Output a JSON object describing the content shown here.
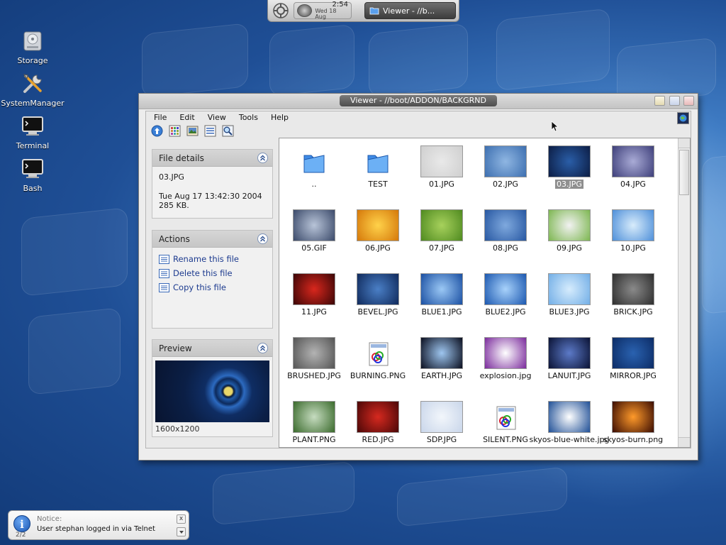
{
  "taskbar": {
    "time": "2:54",
    "date": "Wed 18 Aug",
    "task_label": "Viewer - //b..."
  },
  "desktop_icons": [
    {
      "label": "Storage",
      "icon": "storage-icon"
    },
    {
      "label": "SystemManager",
      "icon": "tools-icon"
    },
    {
      "label": "Terminal",
      "icon": "terminal-icon"
    },
    {
      "label": "Bash",
      "icon": "terminal-icon"
    }
  ],
  "window": {
    "title": "Viewer - //boot/ADDON/BACKGRND",
    "menu": [
      "File",
      "Edit",
      "View",
      "Tools",
      "Help"
    ],
    "toolbar": [
      "up-icon",
      "grid-view-icon",
      "thumbnail-view-icon",
      "list-view-icon",
      "search-icon"
    ]
  },
  "file_details": {
    "header": "File details",
    "filename": "03.JPG",
    "date": "Tue Aug 17 13:42:30 2004",
    "size": "285 KB."
  },
  "actions": {
    "header": "Actions",
    "items": [
      "Rename this file",
      "Delete this file",
      "Copy this file"
    ]
  },
  "preview": {
    "header": "Preview",
    "dimensions": "1600x1200"
  },
  "files": [
    {
      "name": "..",
      "kind": "folder"
    },
    {
      "name": "TEST",
      "kind": "folder"
    },
    {
      "name": "01.JPG",
      "kind": "image",
      "colors": [
        "#e9e9e9",
        "#cfcfcf"
      ]
    },
    {
      "name": "02.JPG",
      "kind": "image",
      "colors": [
        "#8fb6e2",
        "#3d6fb0"
      ]
    },
    {
      "name": "03.JPG",
      "kind": "image",
      "colors": [
        "#2a5ea8",
        "#0c1d44"
      ],
      "selected": true
    },
    {
      "name": "04.JPG",
      "kind": "image",
      "colors": [
        "#a9abd6",
        "#3e3f7a"
      ]
    },
    {
      "name": "05.GIF",
      "kind": "image",
      "colors": [
        "#b8c4d8",
        "#3b4a6a"
      ]
    },
    {
      "name": "06.JPG",
      "kind": "image",
      "colors": [
        "#ffd24a",
        "#d5780a"
      ]
    },
    {
      "name": "07.JPG",
      "kind": "image",
      "colors": [
        "#a7d15c",
        "#4f8a20"
      ]
    },
    {
      "name": "08.JPG",
      "kind": "image",
      "colors": [
        "#7fa9de",
        "#2858a2"
      ]
    },
    {
      "name": "09.JPG",
      "kind": "image",
      "colors": [
        "#f2f2f2",
        "#7cb650"
      ]
    },
    {
      "name": "10.JPG",
      "kind": "image",
      "colors": [
        "#d8ecfb",
        "#4e8fd9"
      ]
    },
    {
      "name": "11.JPG",
      "kind": "image",
      "colors": [
        "#d9271d",
        "#3b0606"
      ]
    },
    {
      "name": "BEVEL.JPG",
      "kind": "image",
      "colors": [
        "#4a7fc6",
        "#102a5c"
      ]
    },
    {
      "name": "BLUE1.JPG",
      "kind": "image",
      "colors": [
        "#9bc8f5",
        "#1a4fa2"
      ]
    },
    {
      "name": "BLUE2.JPG",
      "kind": "image",
      "colors": [
        "#a8d2fb",
        "#1c58b0"
      ]
    },
    {
      "name": "BLUE3.JPG",
      "kind": "image",
      "colors": [
        "#d6ecfd",
        "#72aee6"
      ]
    },
    {
      "name": "BRICK.JPG",
      "kind": "image",
      "colors": [
        "#8a8a8a",
        "#2e2e2e"
      ]
    },
    {
      "name": "BRUSHED.JPG",
      "kind": "image",
      "colors": [
        "#b3b3b3",
        "#555555"
      ]
    },
    {
      "name": "BURNING.PNG",
      "kind": "document"
    },
    {
      "name": "EARTH.JPG",
      "kind": "image",
      "colors": [
        "#9ec6f0",
        "#0a0e1e"
      ]
    },
    {
      "name": "explosion.jpg",
      "kind": "image",
      "colors": [
        "#ffffff",
        "#7a2a9c"
      ]
    },
    {
      "name": "LANUIT.JPG",
      "kind": "image",
      "colors": [
        "#5c7ac8",
        "#0a1234"
      ]
    },
    {
      "name": "MIRROR.JPG",
      "kind": "image",
      "colors": [
        "#2a62b0",
        "#0c2c66"
      ]
    },
    {
      "name": "PLANT.PNG",
      "kind": "image",
      "colors": [
        "#c6dcc0",
        "#3a6a2c"
      ]
    },
    {
      "name": "RED.JPG",
      "kind": "image",
      "colors": [
        "#d6291f",
        "#4a0707"
      ]
    },
    {
      "name": "SDP.JPG",
      "kind": "image",
      "colors": [
        "#f2f6fb",
        "#c9d6ea"
      ]
    },
    {
      "name": "SILENT.PNG",
      "kind": "document"
    },
    {
      "name": "skyos-blue-white.jpg",
      "kind": "image",
      "colors": [
        "#ffffff",
        "#1f4f96"
      ]
    },
    {
      "name": "skyos-burn.png",
      "kind": "image",
      "colors": [
        "#ff9a2a",
        "#3a0c02"
      ]
    }
  ],
  "notice": {
    "title": "Notice:",
    "message": "User stephan logged in via Telnet",
    "count": "2/2"
  }
}
